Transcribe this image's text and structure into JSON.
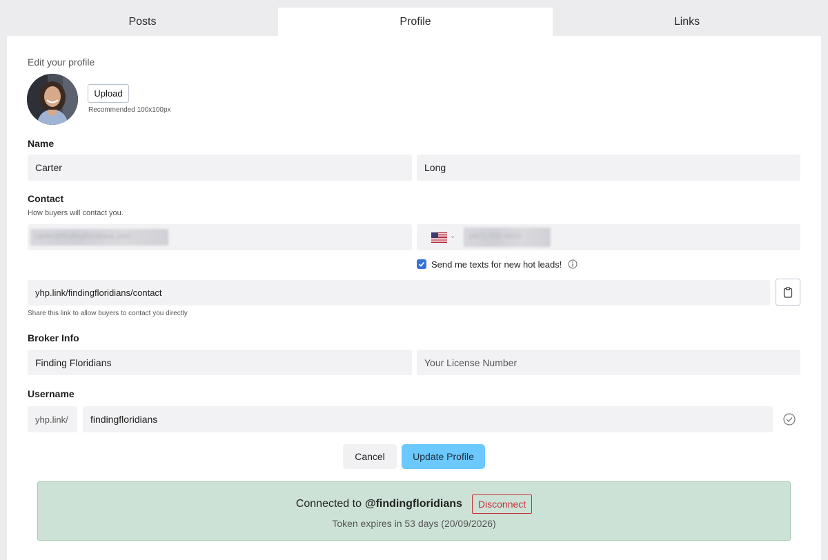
{
  "tabs": [
    {
      "label": "Posts"
    },
    {
      "label": "Profile"
    },
    {
      "label": "Links"
    }
  ],
  "profile": {
    "edit_title": "Edit your profile",
    "upload_label": "Upload",
    "upload_hint": "Recommended 100x100px"
  },
  "name": {
    "label": "Name",
    "first": "Carter",
    "last": "Long"
  },
  "contact": {
    "label": "Contact",
    "sublabel": "How buyers will contact you.",
    "email": "carter@findingfloridians.com",
    "phone": "(407) 555-0000",
    "country_icon": "us-flag-icon",
    "sms_optin_label": "Send me texts for new hot leads!",
    "sms_optin_checked": true
  },
  "contact_link": {
    "value": "yhp.link/findingfloridians/contact",
    "hint": "Share this link to allow buyers to contact you directly"
  },
  "broker": {
    "label": "Broker Info",
    "name": "Finding Floridians",
    "license_placeholder": "Your License Number"
  },
  "username": {
    "label": "Username",
    "prefix": "yhp.link/",
    "value": "findingfloridians"
  },
  "actions": {
    "cancel": "Cancel",
    "update": "Update Profile"
  },
  "connection": {
    "prefix": "Connected to",
    "handle": "@findingfloridians",
    "disconnect": "Disconnect",
    "token": "Token expires in 53 days  (20/09/2026)"
  },
  "colors": {
    "accent": "#6cc9ff",
    "checkbox": "#3772d8",
    "connected_bg": "#cde2d6",
    "danger": "#c8303a"
  }
}
